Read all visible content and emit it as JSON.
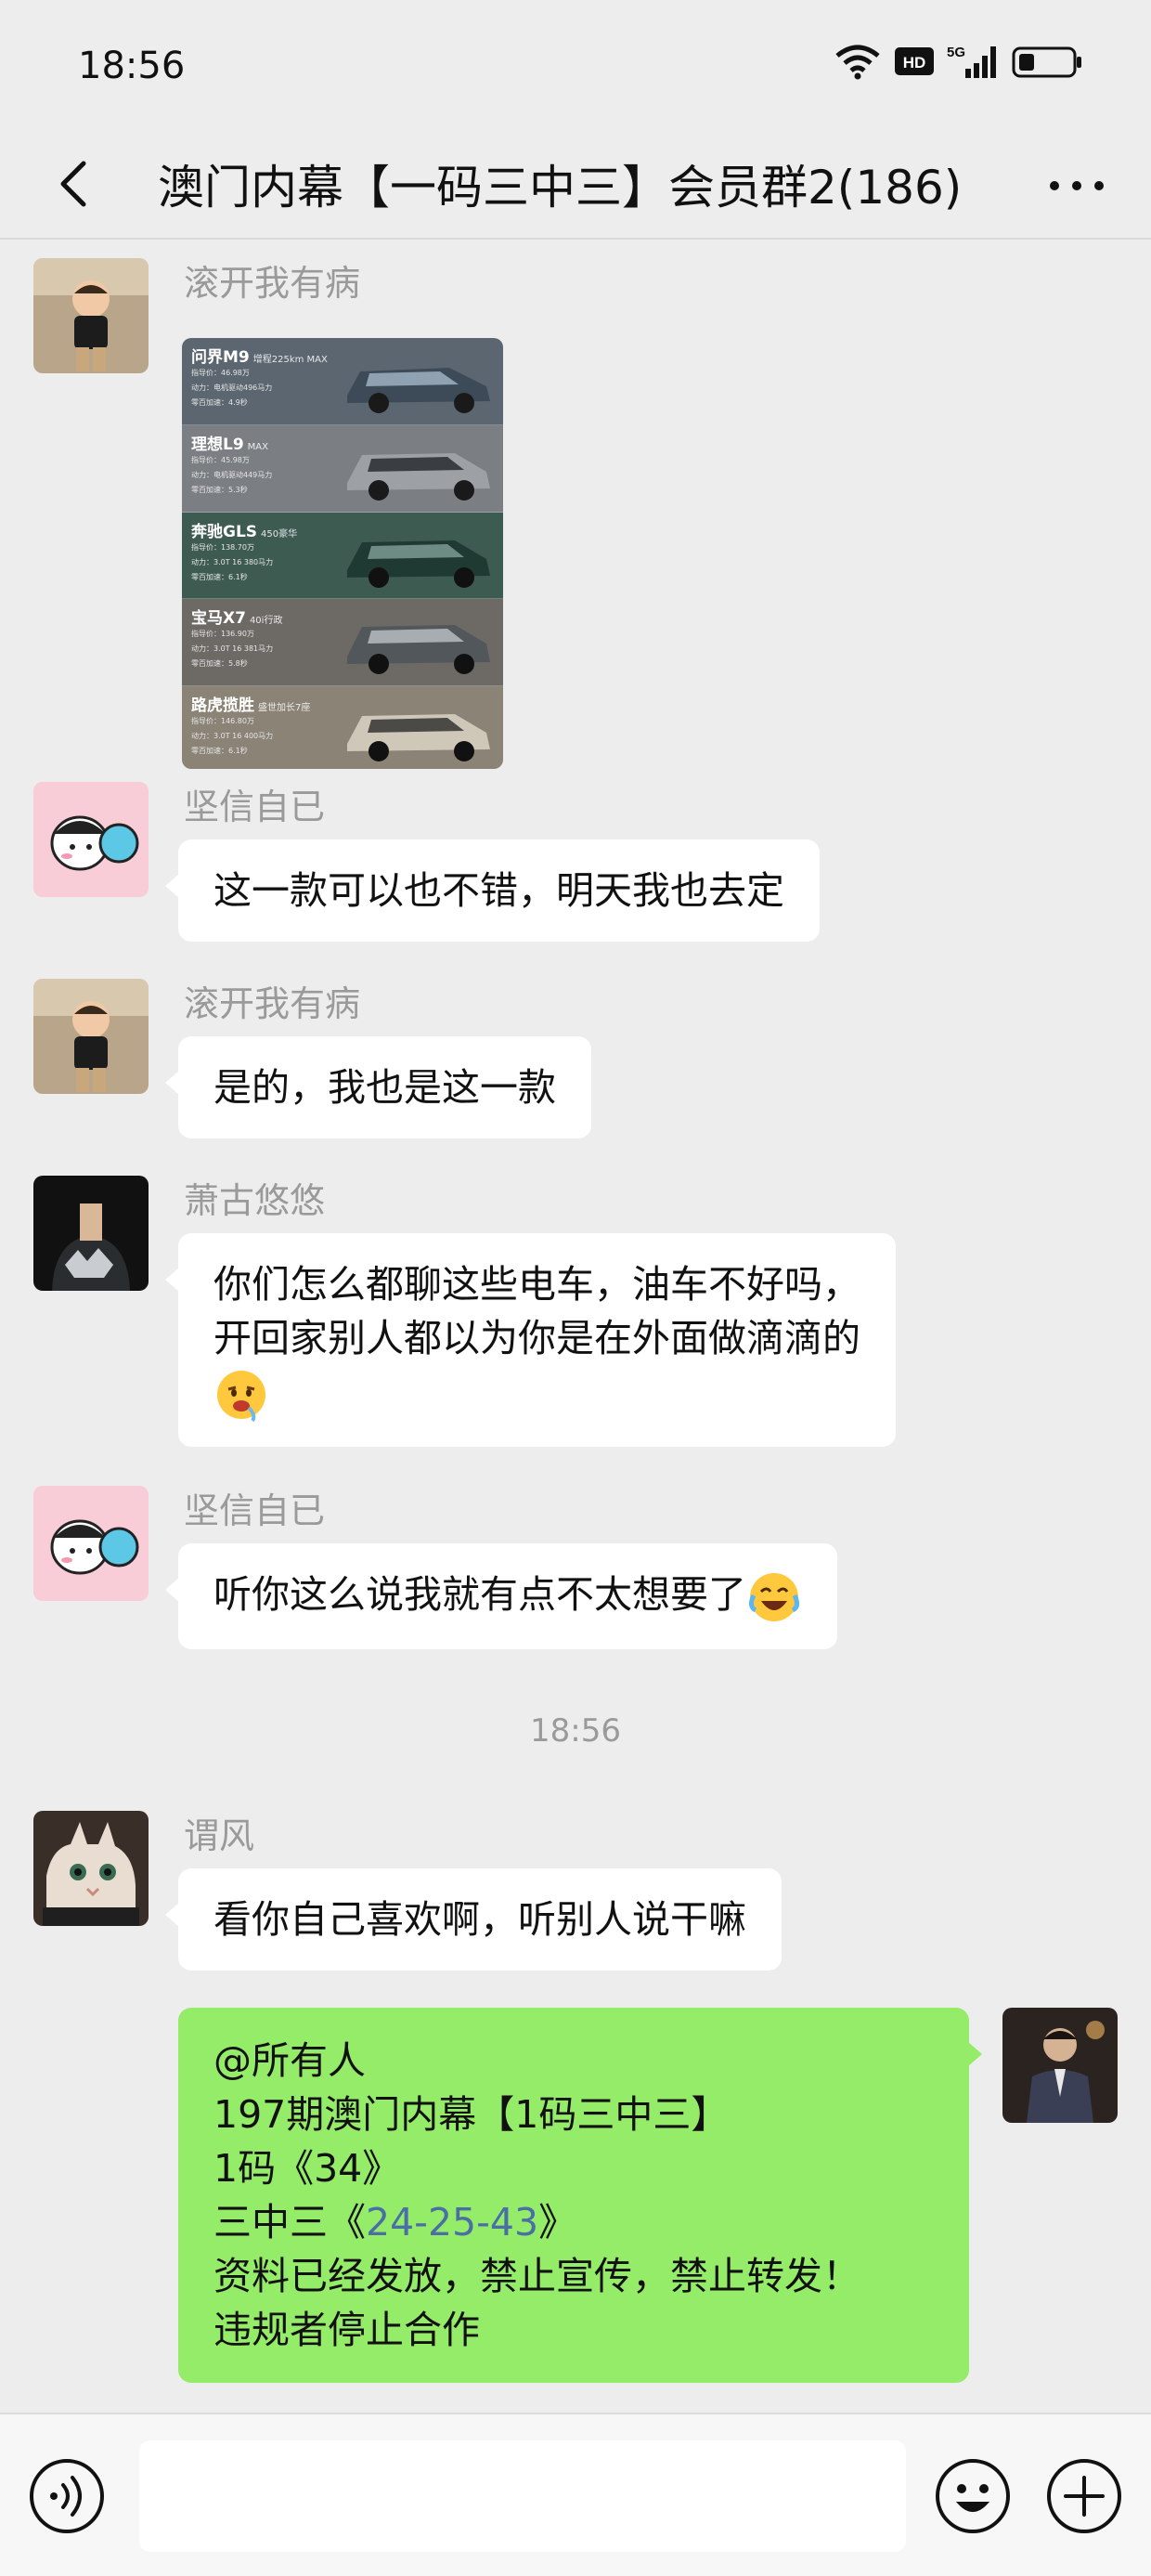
{
  "status_bar": {
    "time": "18:56",
    "icons": [
      "wifi-icon",
      "hd-icon",
      "5g-signal-icon",
      "battery-icon"
    ],
    "hd_label": "HD",
    "network_label": "5G"
  },
  "header": {
    "title": "澳门内幕【一码三中三】会员群2(186)",
    "back_icon": "chevron-left-icon",
    "more_icon": "more-dots-icon"
  },
  "image_card": {
    "cars": [
      {
        "name": "问界M9",
        "variant": "增程225km MAX",
        "specs": [
          "指导价：46.98万",
          "动力：电机驱动496马力",
          "零百加速：4.9秒"
        ]
      },
      {
        "name": "理想L9",
        "variant": "MAX",
        "specs": [
          "指导价：45.98万",
          "动力：电机驱动449马力",
          "零百加速：5.3秒"
        ]
      },
      {
        "name": "奔驰GLS",
        "variant": "450豪华",
        "specs": [
          "指导价：138.70万",
          "动力：3.0T 16 380马力",
          "零百加速：6.1秒"
        ]
      },
      {
        "name": "宝马X7",
        "variant": "40i行政",
        "specs": [
          "指导价：136.90万",
          "动力：3.0T 16 381马力",
          "零百加速：5.8秒"
        ]
      },
      {
        "name": "路虎揽胜",
        "variant": "盛世加长7座",
        "specs": [
          "指导价：146.80万",
          "动力：3.0T 16 400马力",
          "零百加速：6.1秒"
        ]
      }
    ]
  },
  "messages": [
    {
      "sender": "滚开我有病",
      "type": "image"
    },
    {
      "sender": "坚信自已",
      "text": "这一款可以也不错，明天我也去定"
    },
    {
      "sender": "滚开我有病",
      "text": "是的，我也是这一款"
    },
    {
      "sender": "萧古悠悠",
      "lines": [
        "你们怎么都聊这些电车，油车不好吗，",
        "开回家别人都以为你是在外面做滴滴的"
      ],
      "emoji": "drooling-face-icon"
    },
    {
      "sender": "坚信自已",
      "text": "听你这么说我就有点不太想要了",
      "emoji": "crying-laughing-icon"
    },
    {
      "sender": "谓风",
      "text": "看你自己喜欢啊，听别人说干嘛"
    },
    {
      "sender": "self",
      "lines": [
        "@所有人",
        "197期澳门内幕【1码三中三】",
        "1码《34》"
      ],
      "line4_prefix": "三中三《",
      "line4_link": "24-25-43",
      "line4_suffix": "》",
      "lines_after": [
        "资料已经发放，禁止宣传，禁止转发！",
        "违规者停止合作"
      ]
    }
  ],
  "timestamp": "18:56",
  "colors": {
    "background": "#ededed",
    "bubble_self": "#95ec69",
    "bubble_other": "#ffffff",
    "sender_name": "#9a9a9a",
    "link": "#4a6fa5"
  },
  "input_bar": {
    "icons": [
      "voice-icon",
      "emoji-icon",
      "plus-icon"
    ]
  }
}
